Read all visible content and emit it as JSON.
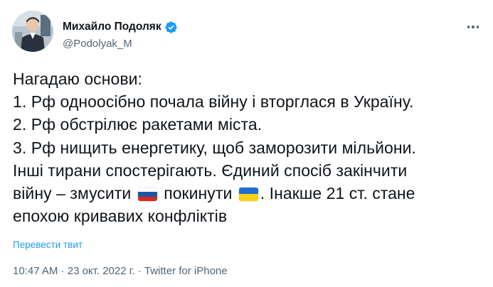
{
  "author": {
    "display_name": "Михайло Подоляк",
    "handle": "@Podolyak_M",
    "verified": true
  },
  "menu": {
    "icon": "more-horizontal-icon"
  },
  "tweet": {
    "lines": [
      "Нагадаю основи:",
      "1. Рф одноосібно почала війну і вторглася в Україну.",
      "2. Рф обстрілює ракетами міста.",
      "3. Рф нищить енергетику, щоб заморозити мільйони.",
      "Інші тирани спостерігають. Єдиний спосіб закінчити",
      "епохою кривавих конфліктів"
    ],
    "line6_part1": "війну – змусити",
    "line6_part2": "покинути",
    "line6_part3": ". Інакше 21 ст. стане",
    "flag_ru": "russia-flag-emoji",
    "flag_ua": "ukraine-flag-emoji"
  },
  "translate_label": "Перевести твит",
  "meta": {
    "time": "10:47 AM",
    "separator1": " · ",
    "date": "23 окт. 2022 г.",
    "separator2": " · ",
    "source": "Twitter for iPhone"
  },
  "colors": {
    "link": "#1d9bf0",
    "secondary_text": "#536471",
    "primary_text": "#0f1419",
    "verified_badge": "#1d9bf0"
  }
}
